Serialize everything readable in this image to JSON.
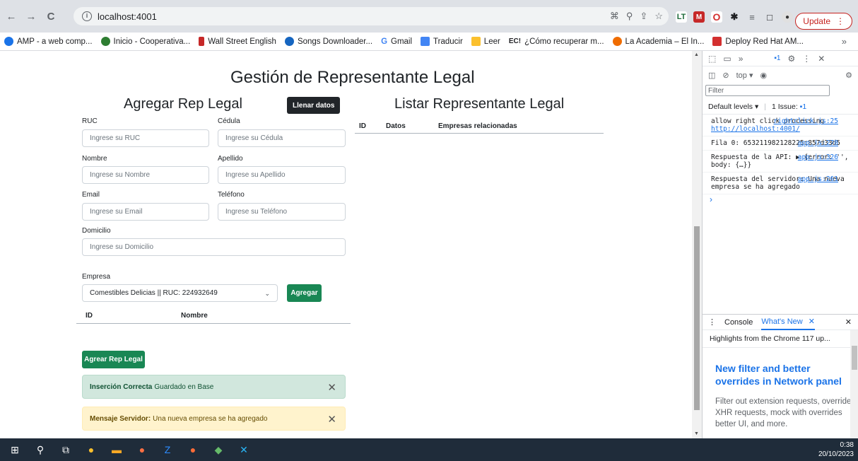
{
  "browser": {
    "url": "localhost:4001",
    "update_label": "Update",
    "bookmarks": [
      {
        "label": "AMP - a web comp...",
        "color": "#1a73e8"
      },
      {
        "label": "Inicio - Cooperativa...",
        "color": "#2e7d32"
      },
      {
        "label": "Wall Street English",
        "color": "#c62828"
      },
      {
        "label": "Songs Downloader...",
        "color": "#1565c0"
      },
      {
        "label": "Gmail",
        "color": "#4285f4"
      },
      {
        "label": "Traducir",
        "color": "#4285f4"
      },
      {
        "label": "Leer",
        "color": "#fbc02d"
      },
      {
        "label": "¿Cómo recuperar m...",
        "color": "#000000",
        "prefix": "EC!"
      },
      {
        "label": "La Academia – El In...",
        "color": "#ef6c00"
      },
      {
        "label": "Deploy Red Hat AM...",
        "color": "#d32f2f"
      }
    ],
    "bookmarks_more": "»"
  },
  "page": {
    "title": "Gestión de Representante Legal",
    "form_title": "Agregar Rep Legal",
    "fill_button": "Llenar datos",
    "list_title": "Listar Representante Legal",
    "fields": {
      "ruc": {
        "label": "RUC",
        "placeholder": "Ingrese su RUC"
      },
      "cedula": {
        "label": "Cédula",
        "placeholder": "Ingrese su Cédula"
      },
      "nombre": {
        "label": "Nombre",
        "placeholder": "Ingrese su Nombre"
      },
      "apellido": {
        "label": "Apellido",
        "placeholder": "Ingrese su Apellido"
      },
      "email": {
        "label": "Email",
        "placeholder": "Ingrese su Email"
      },
      "telefono": {
        "label": "Teléfono",
        "placeholder": "Ingrese su Teléfono"
      },
      "domicilio": {
        "label": "Domicilio",
        "placeholder": "Ingrese su Domicilio"
      }
    },
    "empresa": {
      "label": "Empresa",
      "selected": "Comestibles Delicias || RUC: 224932649",
      "add_button": "Agregar"
    },
    "empresa_table": {
      "columns": [
        "ID",
        "Nombre"
      ]
    },
    "list_table": {
      "columns": [
        "ID",
        "Datos",
        "Empresas relacionadas"
      ]
    },
    "submit_button": "Agrear Rep Legal",
    "alerts": {
      "success": {
        "strong": "Inserción Correcta",
        "text": "Guardado en Base"
      },
      "warning": {
        "strong": "Mensaje Servidor:",
        "text": "Una nueva empresa se ha agregado"
      }
    }
  },
  "devtools": {
    "context": "top",
    "issues_badge": "1",
    "filter_placeholder": "Filter",
    "levels_label": "Default levels",
    "issues_label": "1 Issue:",
    "issues_count": "1",
    "messages": [
      {
        "text": "allow right click processing",
        "link": "http://localhost:4001/",
        "source": "rightclick.js:25"
      },
      {
        "text": "Fila 0: 653211982128225c857d33d5",
        "source": "app.js:278"
      },
      {
        "text": "Respuesta de la API: ▶ {error: '', body: {…}}",
        "source": "app.js:326"
      },
      {
        "text": "Respuesta del servidor: Una nueva empresa se ha agregado",
        "source": "app.js:261"
      }
    ],
    "drawer": {
      "tab_console": "Console",
      "tab_whats_new": "What's New",
      "highlights": "Highlights from the Chrome 117 up...",
      "headline": "New filter and better overrides in Network panel",
      "body": "Filter out extension requests, override XHR requests, mock with overrides better UI, and more."
    }
  },
  "taskbar": {
    "time": "0:38",
    "date": "20/10/2023"
  }
}
